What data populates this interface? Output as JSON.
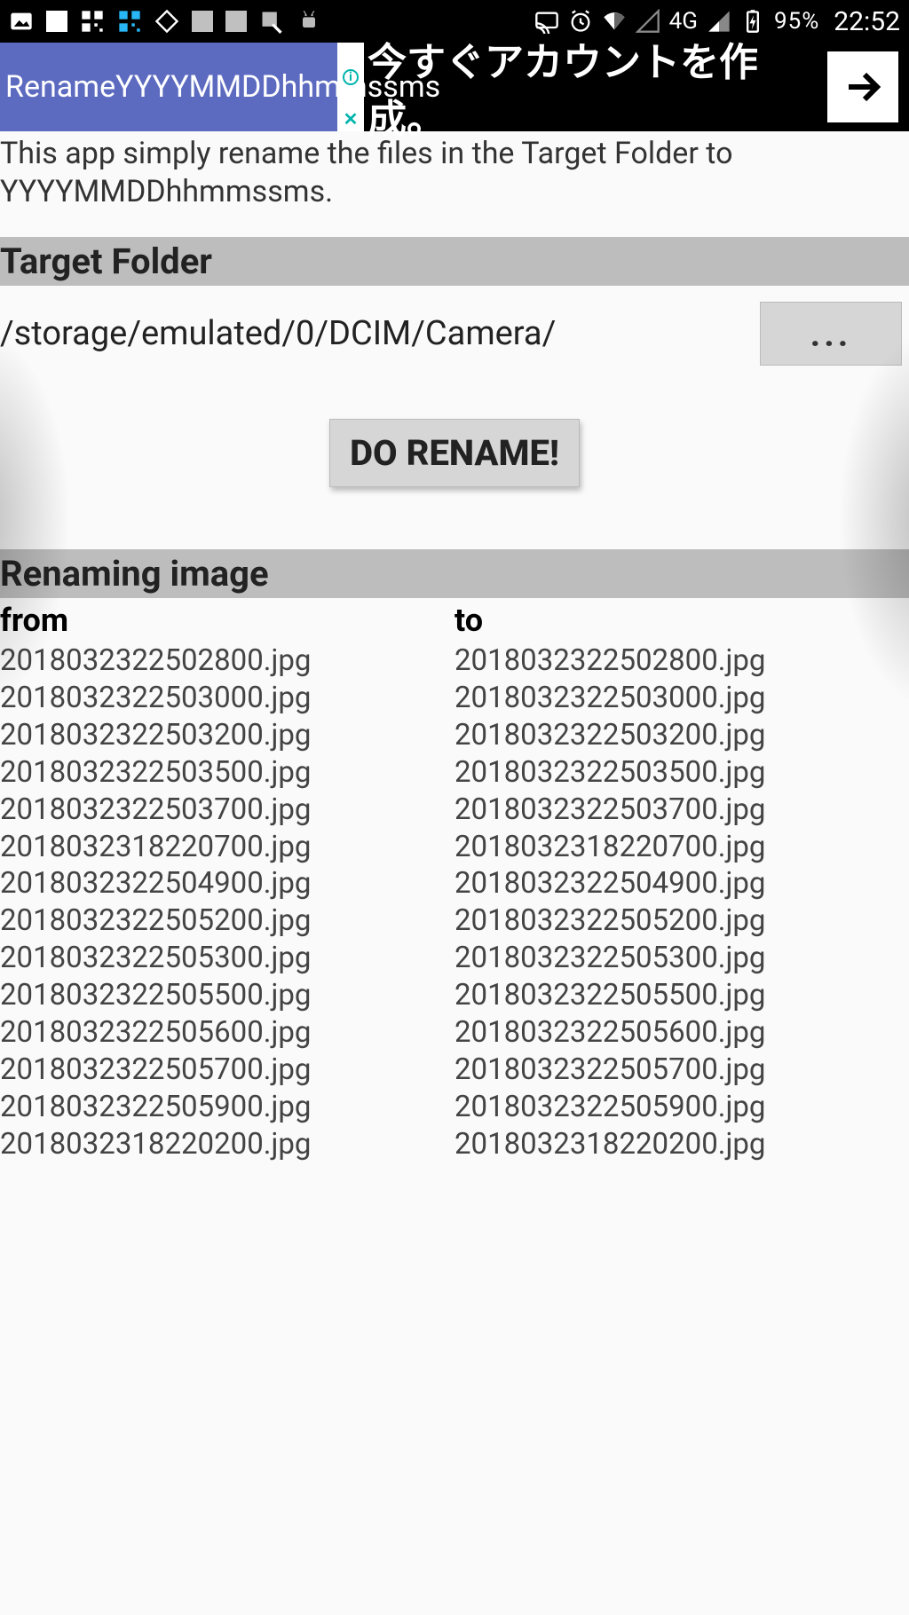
{
  "status_bar": {
    "battery_pct": "95%",
    "clock": "22:52",
    "network": "4G"
  },
  "header": {
    "app_title": "RenameYYYYMMDDhhmmssms",
    "ad_text": "今すぐアカウントを作成。"
  },
  "description": "This app simply rename the files in the Target Folder to YYYYMMDDhhmmssms.",
  "sections": {
    "target_folder": "Target Folder",
    "renaming_image": "Renaming image"
  },
  "target": {
    "path": "/storage/emulated/0/DCIM/Camera/",
    "browse_label": "...",
    "button_label": "DO RENAME!"
  },
  "table": {
    "from_label": "from",
    "to_label": "to",
    "rows": [
      {
        "from": "2018032322502800.jpg",
        "to": "2018032322502800.jpg"
      },
      {
        "from": "2018032322503000.jpg",
        "to": "2018032322503000.jpg"
      },
      {
        "from": "2018032322503200.jpg",
        "to": "2018032322503200.jpg"
      },
      {
        "from": "2018032322503500.jpg",
        "to": "2018032322503500.jpg"
      },
      {
        "from": "2018032322503700.jpg",
        "to": "2018032322503700.jpg"
      },
      {
        "from": "2018032318220700.jpg",
        "to": "2018032318220700.jpg"
      },
      {
        "from": "2018032322504900.jpg",
        "to": "2018032322504900.jpg"
      },
      {
        "from": "2018032322505200.jpg",
        "to": "2018032322505200.jpg"
      },
      {
        "from": "2018032322505300.jpg",
        "to": "2018032322505300.jpg"
      },
      {
        "from": "2018032322505500.jpg",
        "to": "2018032322505500.jpg"
      },
      {
        "from": "2018032322505600.jpg",
        "to": "2018032322505600.jpg"
      },
      {
        "from": "2018032322505700.jpg",
        "to": "2018032322505700.jpg"
      },
      {
        "from": "2018032322505900.jpg",
        "to": "2018032322505900.jpg"
      },
      {
        "from": "2018032318220200.jpg",
        "to": "2018032318220200.jpg"
      }
    ]
  }
}
